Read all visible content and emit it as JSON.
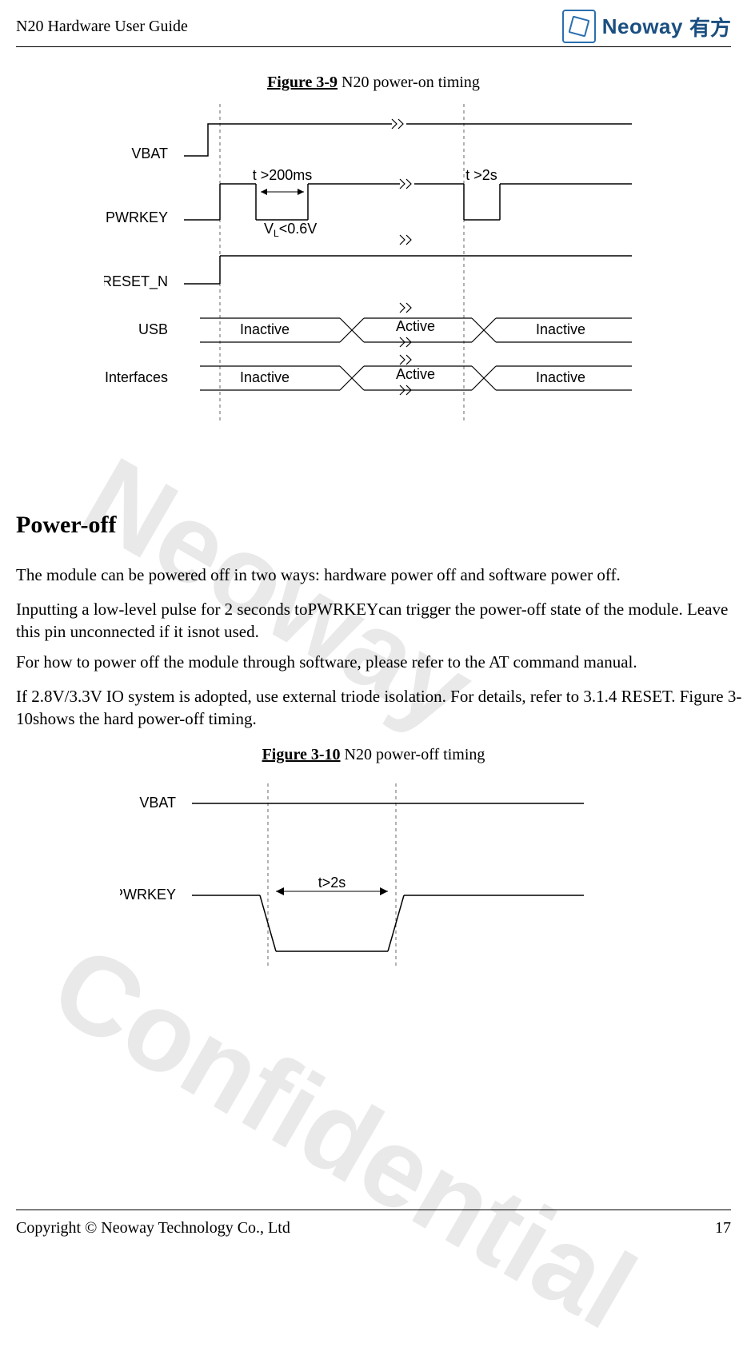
{
  "header": {
    "doc_title": "N20 Hardware User Guide",
    "logo_word": "Neoway",
    "logo_cn": "有方"
  },
  "figure1": {
    "caption_prefix": "Figure 3-9",
    "caption_rest": " N20 power-on timing",
    "labels": {
      "vbat": "VBAT",
      "pwrkey": "PWRKEY",
      "reset": "RESET_N",
      "usb": "USB",
      "allif": "All Interfaces",
      "t200": "t >200ms",
      "vl": "V",
      "vl_sub": "L",
      "vl_rest": "<0.6V",
      "t2s": "t >2s",
      "inactive": "Inactive",
      "active": "Active"
    }
  },
  "section": {
    "heading": "Power-off",
    "p1": "The module can be powered off in two ways: hardware power off and software power off.",
    "p2": "Inputting a low-level pulse for 2 seconds toPWRKEYcan trigger the power-off state of the module. Leave this pin unconnected if it isnot used.",
    "p3": "For how to power off the module through software, please refer to the AT command manual.",
    "p4": "If 2.8V/3.3V IO system is adopted, use external triode isolation. For details, refer to 3.1.4 RESET. Figure 3-10shows the hard power-off timing."
  },
  "figure2": {
    "caption_prefix": "Figure 3-10",
    "caption_rest": " N20 power-off timing",
    "labels": {
      "vbat": "VBAT",
      "pwrkey": "PWRKEY",
      "t2s": "t>2s"
    }
  },
  "watermarks": {
    "wm1": "Neoway",
    "wm2": "Confidential"
  },
  "footer": {
    "copyright": "Copyright © Neoway Technology Co., Ltd",
    "page": "17"
  },
  "chart_data": [
    {
      "type": "timing-diagram",
      "title": "Figure 3-9 N20 power-on timing",
      "signals": [
        {
          "name": "VBAT",
          "segments": [
            {
              "level": "low"
            },
            {
              "level": "high",
              "note": "stays high"
            }
          ]
        },
        {
          "name": "PWRKEY",
          "segments": [
            {
              "level": "high"
            },
            {
              "level": "low",
              "duration": ">200ms",
              "threshold": "VL<0.6V"
            },
            {
              "level": "high"
            },
            {
              "level": "low",
              "duration": ">2s"
            },
            {
              "level": "high"
            }
          ]
        },
        {
          "name": "RESET_N",
          "segments": [
            {
              "level": "low"
            },
            {
              "level": "high"
            }
          ]
        },
        {
          "name": "USB",
          "states": [
            "Inactive",
            "Active",
            "Inactive"
          ]
        },
        {
          "name": "All Interfaces",
          "states": [
            "Inactive",
            "Active",
            "Inactive"
          ]
        }
      ]
    },
    {
      "type": "timing-diagram",
      "title": "Figure 3-10 N20 power-off timing",
      "signals": [
        {
          "name": "VBAT",
          "segments": [
            {
              "level": "high"
            }
          ]
        },
        {
          "name": "PWRKEY",
          "segments": [
            {
              "level": "high"
            },
            {
              "level": "low",
              "duration": ">2s"
            },
            {
              "level": "high"
            }
          ]
        }
      ]
    }
  ]
}
